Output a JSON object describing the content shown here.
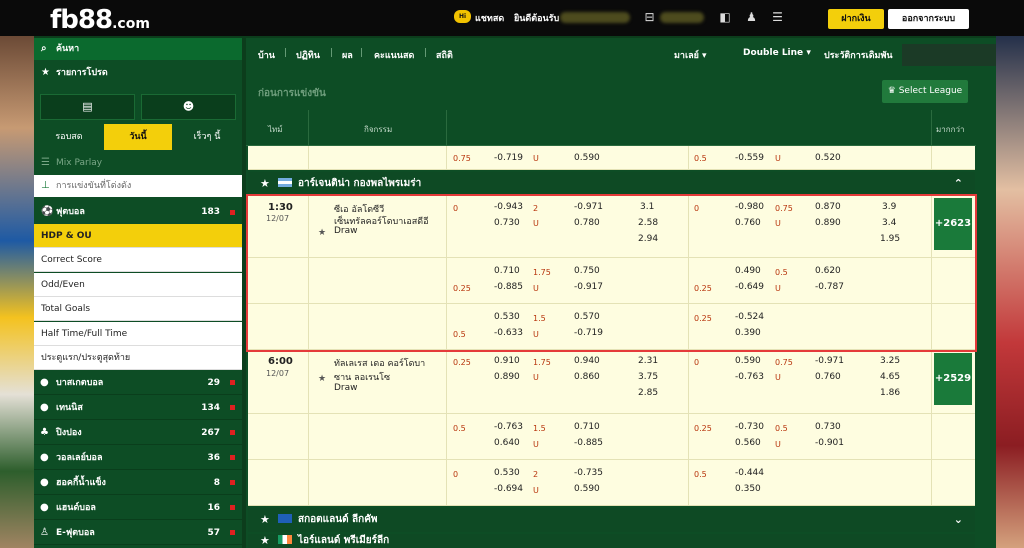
{
  "header": {
    "logo": "fb88",
    "logo_tld": ".com",
    "chat_label": "แชทสด",
    "greeting": "ยินดีต้อนรับ",
    "deposit": "ฝากเงิน",
    "logout": "ออกจากระบบ",
    "chat_icon_text": "Hi"
  },
  "sidebar": {
    "search": "ค้นหา",
    "favorites": "รายการโปรด",
    "tabs": [
      "รอบสด",
      "วันนี้",
      "เร็วๆ นี้"
    ],
    "mix": "Mix Parlay",
    "pinned": "การแข่งขันที่โด่งดัง",
    "soccer": {
      "label": "ฟุตบอล",
      "count": "183"
    },
    "bet_types": [
      "HDP & OU",
      "Correct Score",
      "Odd/Even",
      "Total Goals",
      "Half Time/Full Time",
      "ประตูแรก/ประตูสุดท้าย"
    ],
    "sports": [
      {
        "label": "บาสเกตบอล",
        "count": "29"
      },
      {
        "label": "เทนนิส",
        "count": "134"
      },
      {
        "label": "ปิงปอง",
        "count": "267"
      },
      {
        "label": "วอลเลย์บอล",
        "count": "36"
      },
      {
        "label": "ฮอคกี้น้ำแข็ง",
        "count": "8"
      },
      {
        "label": "แฮนด์บอล",
        "count": "16"
      },
      {
        "label": "E-ฟุตบอล",
        "count": "57"
      }
    ]
  },
  "nav": {
    "items": [
      "บ้าน",
      "ปฏิทิน",
      "ผล",
      "คะแนนสด",
      "สถิติ"
    ],
    "display": "มาเลย์",
    "line": "Double Line",
    "history": "ประวัติการเดิมพัน"
  },
  "subheader": {
    "title": "ก่อนการแข่งขัน",
    "select_league": "Select League"
  },
  "columns": {
    "time": "ไทม์",
    "event": "กิจกรรม",
    "more": "มากกว่า"
  },
  "partial_row": {
    "c1": "0.75",
    "c2": "-0.719",
    "c3": "U",
    "c4": "0.590",
    "c5": "0.5",
    "c6": "-0.559",
    "c7": "U",
    "c8": "0.520"
  },
  "leagues": [
    {
      "name": "อาร์เจนติน่า กองพลไพรเมร่า"
    },
    {
      "name": "สกอตแลนด์ ลีกคัพ"
    },
    {
      "name": "ไอร์แลนด์ พรีเมียร์ลีก"
    }
  ],
  "matches": [
    {
      "time": "1:30",
      "date": "12/07",
      "home": "ซีเอ อัลโดซีวี",
      "away": "เซ็นทรัลคอร์โดบาเอสดีอี",
      "draw": "Draw",
      "more": "+2623",
      "lines": [
        {
          "fh": "0",
          "f1": "-0.943",
          "f2": "0.730",
          "ou": "2",
          "o1": "-0.971",
          "o2": "0.780",
          "x1": "3.1",
          "x2": "2.58",
          "x3": "2.94",
          "hh": "0",
          "h1": "-0.980",
          "h2": "0.760",
          "hou": "0.75",
          "hu1": "0.870",
          "hu2": "0.890",
          "hx1": "3.9",
          "hx2": "3.4",
          "hx3": "1.95"
        },
        {
          "fh": "0.25",
          "f1": "0.710",
          "f2": "-0.885",
          "ou": "1.75",
          "o1": "0.750",
          "o2": "-0.917",
          "hh": "0.25",
          "h1": "0.490",
          "h2": "-0.649",
          "hou": "0.5",
          "hu1": "0.620",
          "hu2": "-0.787"
        },
        {
          "fh": "0.5",
          "f1": "0.530",
          "f2": "-0.633",
          "ou": "1.5",
          "o1": "0.570",
          "o2": "-0.719",
          "hh": "0.25",
          "h1": "-0.524",
          "h2": "0.390"
        }
      ]
    },
    {
      "time": "6:00",
      "date": "12/07",
      "home": "ทัลเลเรส เดอ คอร์โดบา",
      "away": "ซาน ลอเรนโซ",
      "draw": "Draw",
      "more": "+2529",
      "lines": [
        {
          "fh": "0.25",
          "f1": "0.910",
          "f2": "0.890",
          "ou": "1.75",
          "o1": "0.940",
          "o2": "0.860",
          "x1": "2.31",
          "x2": "3.75",
          "x3": "2.85",
          "hh": "0",
          "h1": "0.590",
          "h2": "-0.763",
          "hou": "0.75",
          "hu1": "-0.971",
          "hu2": "0.760",
          "hx1": "3.25",
          "hx2": "4.65",
          "hx3": "1.86"
        },
        {
          "fh": "0.5",
          "f1": "-0.763",
          "f2": "0.640",
          "ou": "1.5",
          "o1": "0.710",
          "o2": "-0.885",
          "hh": "0.25",
          "h1": "-0.730",
          "h2": "0.560",
          "hou": "0.5",
          "hu1": "0.730",
          "hu2": "-0.901"
        },
        {
          "fh": "0",
          "f1": "0.530",
          "f2": "-0.694",
          "ou": "2",
          "o1": "-0.735",
          "o2": "0.590",
          "hh": "0.5",
          "h1": "-0.444",
          "h2": "0.350"
        }
      ]
    }
  ],
  "ou_label": "U",
  "colors": {
    "accent": "#f3cf0b",
    "bg_green": "#0d4d25",
    "odds_bg": "#fefde0",
    "highlight": "#e53a3a"
  }
}
